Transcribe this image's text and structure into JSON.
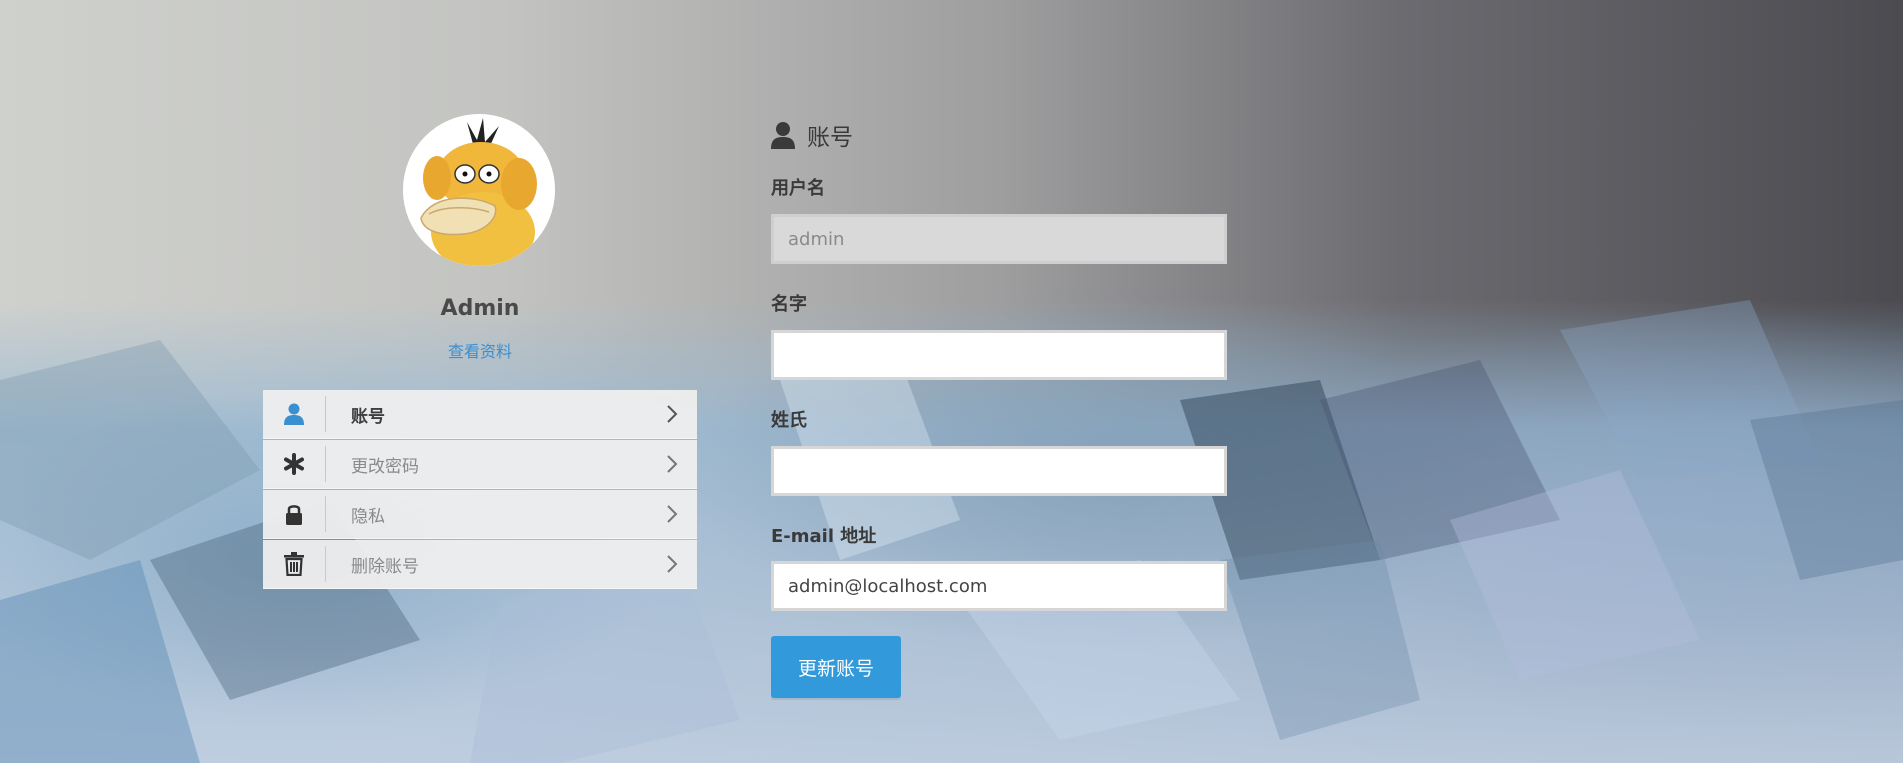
{
  "profile": {
    "name": "Admin",
    "view_profile_link": "查看资料",
    "avatar_icon": "psyduck-avatar"
  },
  "menu": {
    "items": [
      {
        "label": "账号",
        "icon": "user-icon",
        "active": true
      },
      {
        "label": "更改密码",
        "icon": "asterisk-icon",
        "active": false
      },
      {
        "label": "隐私",
        "icon": "lock-icon",
        "active": false
      },
      {
        "label": "删除账号",
        "icon": "trash-icon",
        "active": false
      }
    ]
  },
  "form": {
    "title": "账号",
    "title_icon": "user-icon",
    "username": {
      "label": "用户名",
      "value": "admin",
      "readonly": true
    },
    "first_name": {
      "label": "名字",
      "value": ""
    },
    "last_name": {
      "label": "姓氏",
      "value": ""
    },
    "email": {
      "label": "E-mail 地址",
      "value": "admin@localhost.com"
    },
    "submit_label": "更新账号"
  },
  "colors": {
    "accent": "#3299db",
    "link": "#3a8fd0",
    "active_icon": "#3a8fd0"
  }
}
